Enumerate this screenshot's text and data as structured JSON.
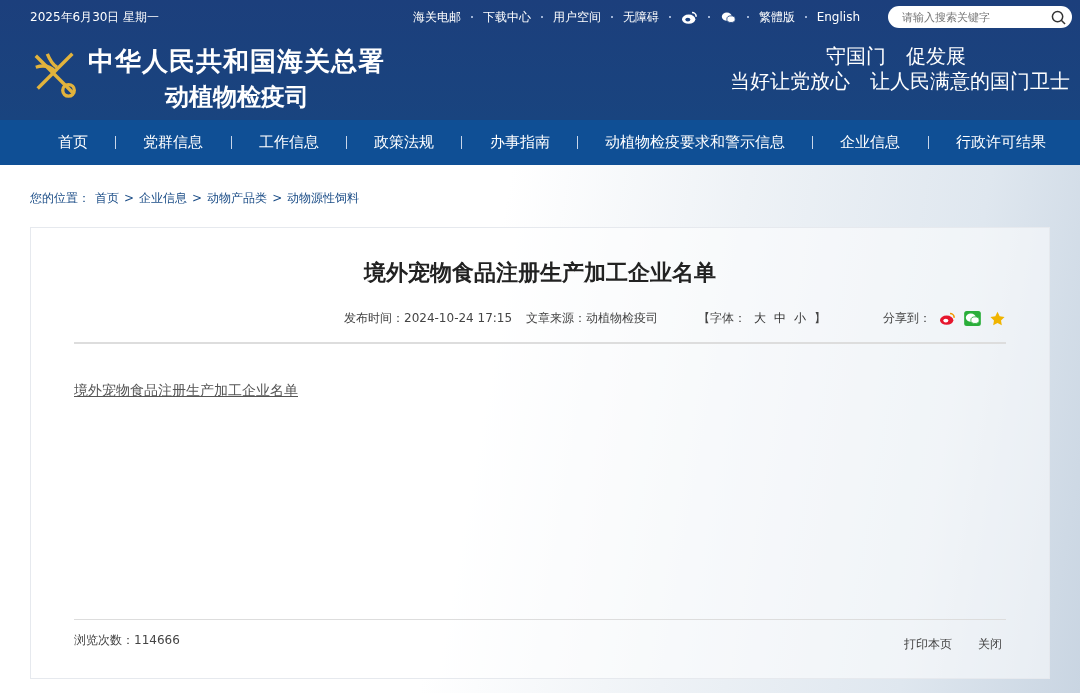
{
  "top_bar": {
    "date": "2025年6月30日 星期一",
    "links": [
      "海关电邮",
      "下载中心",
      "用户空间",
      "无障碍"
    ],
    "icon_links": [
      {
        "kind": "weibo"
      },
      {
        "kind": "wechat"
      }
    ],
    "links_after": [
      "繁體版",
      "English"
    ],
    "search": {
      "placeholder": "请输入搜索关键字"
    }
  },
  "header": {
    "title": "中华人民共和国海关总署",
    "subtitle": "动植物检疫司",
    "slogans": [
      "守国门　促发展",
      "当好让党放心　让人民满意的国门卫士"
    ]
  },
  "nav": [
    {
      "label": "首页"
    },
    {
      "label": "党群信息"
    },
    {
      "label": "工作信息"
    },
    {
      "label": "政策法规"
    },
    {
      "label": "办事指南"
    },
    {
      "label": "动植物检疫要求和警示信息"
    },
    {
      "label": "企业信息"
    },
    {
      "label": "行政许可结果"
    }
  ],
  "breadcrumb": {
    "label": "您的位置：",
    "items": [
      "首页",
      "企业信息",
      "动物产品类",
      "动物源性饲料"
    ],
    "separator": ">"
  },
  "article": {
    "title": "境外宠物食品注册生产加工企业名单",
    "published": "发布时间：2024-10-24 17:15",
    "source": "文章来源：动植物检疫司",
    "font_label": "【字体：",
    "font_sizes": [
      "大",
      "中",
      "小"
    ],
    "font_close": "】",
    "share_label": "分享到：",
    "share": [
      {
        "kind": "weibo"
      },
      {
        "kind": "wechat"
      },
      {
        "kind": "favorite"
      }
    ],
    "attachment": "境外宠物食品注册生产加工企业名单",
    "views": "浏览次数：114666",
    "actions": [
      "打印本页",
      "关闭"
    ]
  }
}
